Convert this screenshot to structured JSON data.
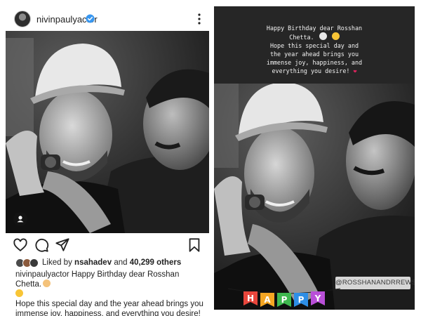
{
  "post": {
    "username": "nivinpaulyactor",
    "icons": {
      "verified": "verified-badge-icon",
      "more": "more-options-icon",
      "user_tag": "user-tag-icon",
      "like": "heart-icon",
      "comment": "comment-icon",
      "share": "send-icon",
      "save": "bookmark-icon"
    },
    "likes": {
      "prefix": "Liked by",
      "user": "nsahadev",
      "joiner": "and",
      "count": "40,299 others"
    },
    "caption": {
      "user": "nivinpaulyactor",
      "line1": "Happy Birthday dear Rosshan Chetta.",
      "line2": "Hope  this special day and the year ahead brings you immense joy, happiness, and everything you desire!"
    }
  },
  "story": {
    "lines": [
      "Happy Birthday dear Rosshan",
      "Chetta.",
      "Hope  this special day and",
      "the year ahead brings you",
      "immense joy, happiness, and",
      "everything you desire!"
    ],
    "mention": "@ROSSHANANDRREWS",
    "banner_letters": [
      "H",
      "A",
      "P",
      "P",
      "Y"
    ]
  },
  "colors": {
    "verified": "#3897f0",
    "heart": "#e0245e",
    "text": "#262626",
    "story_bg": "#262626"
  }
}
